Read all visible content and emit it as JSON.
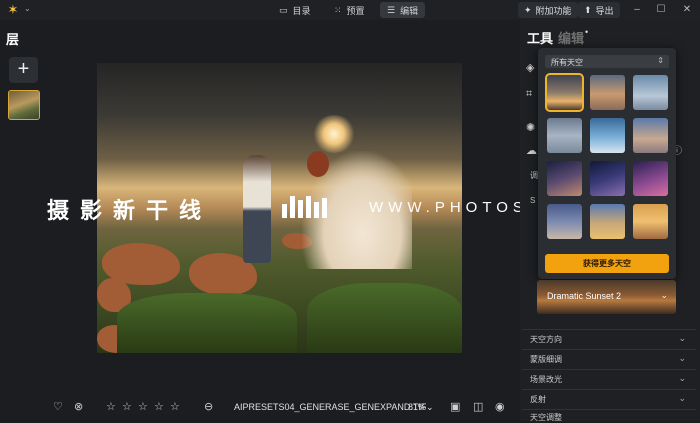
{
  "topbar": {
    "app_caret": "⌄",
    "tabs": [
      {
        "label": "目录",
        "icon": "folder-icon"
      },
      {
        "label": "预置",
        "icon": "presets-icon"
      },
      {
        "label": "编辑",
        "icon": "sliders-icon",
        "active": true
      }
    ],
    "addons_label": "附加功能",
    "export_label": "导出",
    "window": {
      "minimize": "–",
      "maximize": "☐",
      "close": "✕"
    }
  },
  "left_panel": {
    "title": "层",
    "add_label": "+"
  },
  "watermark": {
    "chinese": "摄影新干线",
    "url": "WWW.PHOTOSKS.VIP"
  },
  "bottom_bar": {
    "filename": "AIPRESETS04_GENERASE_GENEXPAND.TIF",
    "zoom": "81%",
    "zoom_caret": "⌄",
    "rating_stars": 5,
    "rating_value": 0
  },
  "right_panel": {
    "tools_label": "工具",
    "edit_label": "编辑",
    "edit_dot": "•",
    "partial_labels": [
      "调",
      "S"
    ],
    "sky_popup": {
      "dropdown_value": "所有天空",
      "get_more_label": "获得更多天空",
      "selected_index": 0
    },
    "preset_name": "Dramatic Sunset 2",
    "sections": [
      {
        "label": "天空方向"
      },
      {
        "label": "蒙版细调"
      },
      {
        "label": "场景改光"
      },
      {
        "label": "反射"
      },
      {
        "label": "天空调整"
      }
    ]
  },
  "colors": {
    "accent": "#f2a20f",
    "selection": "#f0b429",
    "background": "#1b1d20",
    "panel": "#1e2023"
  }
}
